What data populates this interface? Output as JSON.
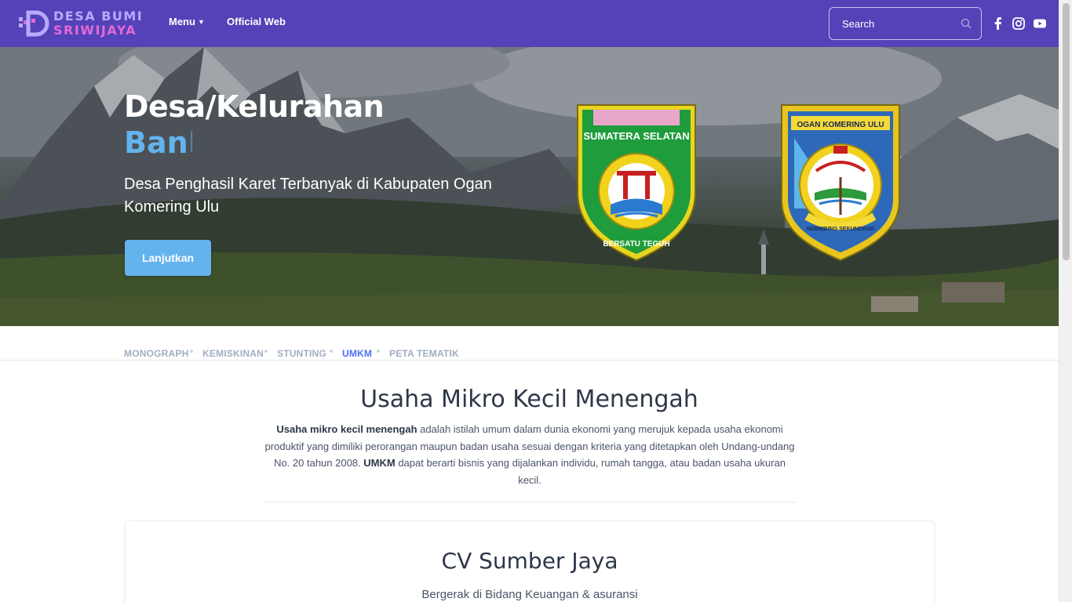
{
  "brand": {
    "line1": "DESA BUMI",
    "line2": "SRIWIJAYA"
  },
  "nav": {
    "menu_label": "Menu",
    "official_label": "Official Web"
  },
  "search": {
    "placeholder": "Search"
  },
  "social": [
    "facebook-icon",
    "instagram-icon",
    "youtube-icon"
  ],
  "hero": {
    "title": "Desa/Kelurahan",
    "subtitle": "Ban",
    "description": "Desa Penghasil Karet Terbanyak di Kabupaten Ogan Komering Ulu",
    "button_label": "Lanjutkan",
    "emblem_left": {
      "top_text": "SUMATERA SELATAN",
      "bottom_text": "BERSATU TEGUH"
    },
    "emblem_right": {
      "top_text": "OGAN KOMERING ULU",
      "bottom_text": "SEBIMBING SEKUNDANG"
    }
  },
  "tabs": [
    {
      "label": "MONOGRAPH",
      "active": false
    },
    {
      "label": "KEMISKINAN",
      "active": false
    },
    {
      "label": "STUNTING",
      "active": false
    },
    {
      "label": "UMKM",
      "active": true
    },
    {
      "label": "PETA TEMATIK",
      "active": false
    }
  ],
  "section": {
    "title": "Usaha Mikro Kecil Menengah",
    "bold1": "Usaha mikro kecil menengah",
    "text1": " adalah istilah umum dalam dunia ekonomi yang merujuk kepada usaha ekonomi produktif yang dimiliki perorangan maupun badan usaha sesuai dengan kriteria yang ditetapkan oleh Undang-undang No. 20 tahun 2008. ",
    "bold2": "UMKM",
    "text2": " dapat berarti bisnis yang dijalankan individu, rumah tangga, atau badan usaha ukuran kecil."
  },
  "card": {
    "title": "CV Sumber Jaya",
    "subtitle": "Bergerak di Bidang Keuangan & asuransi"
  },
  "colors": {
    "navbar": "#5542b8",
    "accent": "#63b3ed",
    "active_tab": "#4c6ef5"
  }
}
